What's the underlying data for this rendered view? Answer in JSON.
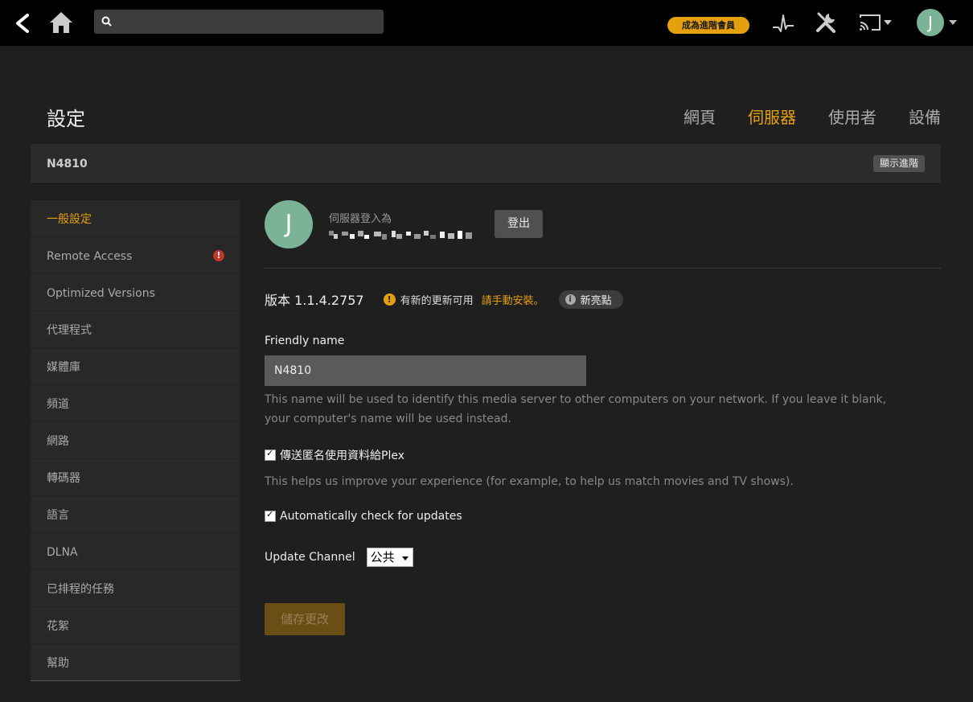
{
  "topbar": {
    "search_placeholder": "",
    "premium_label": "成為進階會員",
    "avatar_letter": "J"
  },
  "header": {
    "title": "設定",
    "tabs": [
      {
        "label": "網頁",
        "active": false
      },
      {
        "label": "伺服器",
        "active": true
      },
      {
        "label": "使用者",
        "active": false
      },
      {
        "label": "設備",
        "active": false
      }
    ]
  },
  "server": {
    "name": "N4810",
    "show_advanced_label": "顯示進階"
  },
  "sidebar": {
    "items": [
      {
        "label": "一般設定",
        "active": true
      },
      {
        "label": "Remote Access",
        "warning": "!"
      },
      {
        "label": "Optimized Versions"
      },
      {
        "label": "代理程式"
      },
      {
        "label": "媒體庫"
      },
      {
        "label": "頻道"
      },
      {
        "label": "網路"
      },
      {
        "label": "轉碼器"
      },
      {
        "label": "語言"
      },
      {
        "label": "DLNA"
      },
      {
        "label": "已排程的任務"
      },
      {
        "label": "花絮"
      },
      {
        "label": "幫助"
      }
    ]
  },
  "account": {
    "avatar_letter": "J",
    "signed_in_label": "伺服器登入為",
    "logout_label": "登出"
  },
  "version": {
    "text": "版本 1.1.4.2757",
    "update_available": "有新的更新可用",
    "manual_install": "請手動安裝。",
    "whats_new": "新亮點"
  },
  "friendly_name": {
    "label": "Friendly name",
    "value": "N4810",
    "help": "This name will be used to identify this media server to other computers on your network. If you leave it blank, your computer's name will be used instead."
  },
  "anonymous_usage": {
    "label": "傳送匿名使用資料給Plex",
    "checked": true,
    "help": "This helps us improve your experience (for example, to help us match movies and TV shows)."
  },
  "auto_update": {
    "label": "Automatically check for updates",
    "checked": true
  },
  "update_channel": {
    "label": "Update Channel",
    "selected": "公共"
  },
  "save_label": "儲存更改",
  "colors": {
    "accent": "#e5a00d",
    "avatar": "#7bb397",
    "warning": "#c0392b"
  }
}
